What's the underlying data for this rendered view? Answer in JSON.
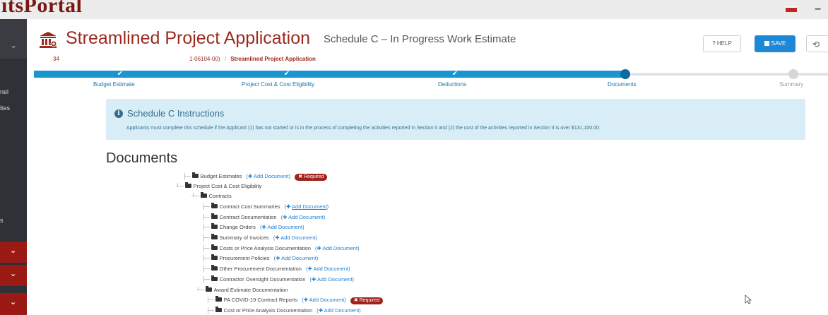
{
  "brand": {
    "text": "ıtsPortal"
  },
  "sidebar": {
    "labels": [
      "nel",
      "ites",
      "s"
    ]
  },
  "header": {
    "title": "Streamlined Project Application",
    "subtitle": "Schedule C – In Progress Work Estimate",
    "breadcrumb": {
      "first": "34",
      "second": "1-06104-00)",
      "separator": "/",
      "current": "Streamlined Project Application"
    },
    "help_label": "? HELP",
    "save_label": "SAVE",
    "undo_label": "⟲"
  },
  "steps": [
    {
      "label": "Budget Estimate",
      "state": "done"
    },
    {
      "label": "Project Cost & Cost Eligibility",
      "state": "done"
    },
    {
      "label": "Deductions",
      "state": "done"
    },
    {
      "label": "Documents",
      "state": "current"
    },
    {
      "label": "Summary",
      "state": "pending"
    }
  ],
  "instructions": {
    "title": "Schedule C Instructions",
    "body": "Applicants must complete this schedule if the Applicant (1) has not started or is in the process of completing the activities reported in Section II and (2) the cost of the activities reported in Section II is over $131,100.00."
  },
  "documents": {
    "heading": "Documents",
    "add_label": "Add Document",
    "required_label": "Required",
    "tree": [
      {
        "label": "Budget Estimates",
        "add": true,
        "required": true
      },
      {
        "label": "Project Cost & Cost Eligibility",
        "add": false,
        "required": false
      },
      {
        "label": "Contracts",
        "add": false,
        "required": false
      },
      {
        "label": "Contract Cost Summaries",
        "add": true,
        "required": false
      },
      {
        "label": "Contract Documentation",
        "add": true,
        "required": false
      },
      {
        "label": "Change Orders",
        "add": true,
        "required": false
      },
      {
        "label": "Summary of Invoices",
        "add": true,
        "required": false
      },
      {
        "label": "Costs or Price Analysis Documentation",
        "add": true,
        "required": false
      },
      {
        "label": "Procurement Policies",
        "add": true,
        "required": false
      },
      {
        "label": "Other Procurement Documentation",
        "add": true,
        "required": false
      },
      {
        "label": "Contractor Oversight Documentation",
        "add": true,
        "required": false
      },
      {
        "label": "Award Estimate Documentation",
        "add": false,
        "required": false
      },
      {
        "label": "PA COVID-19 Contract Reports",
        "add": true,
        "required": true
      },
      {
        "label": "Cost or Price Analysis Documentation",
        "add": true,
        "required": false
      }
    ]
  },
  "colors": {
    "brand": "#9b2a1f",
    "accent": "#1a95cf",
    "save": "#1e88d6",
    "info_bg": "#d9edf7",
    "required": "#a1211b"
  }
}
